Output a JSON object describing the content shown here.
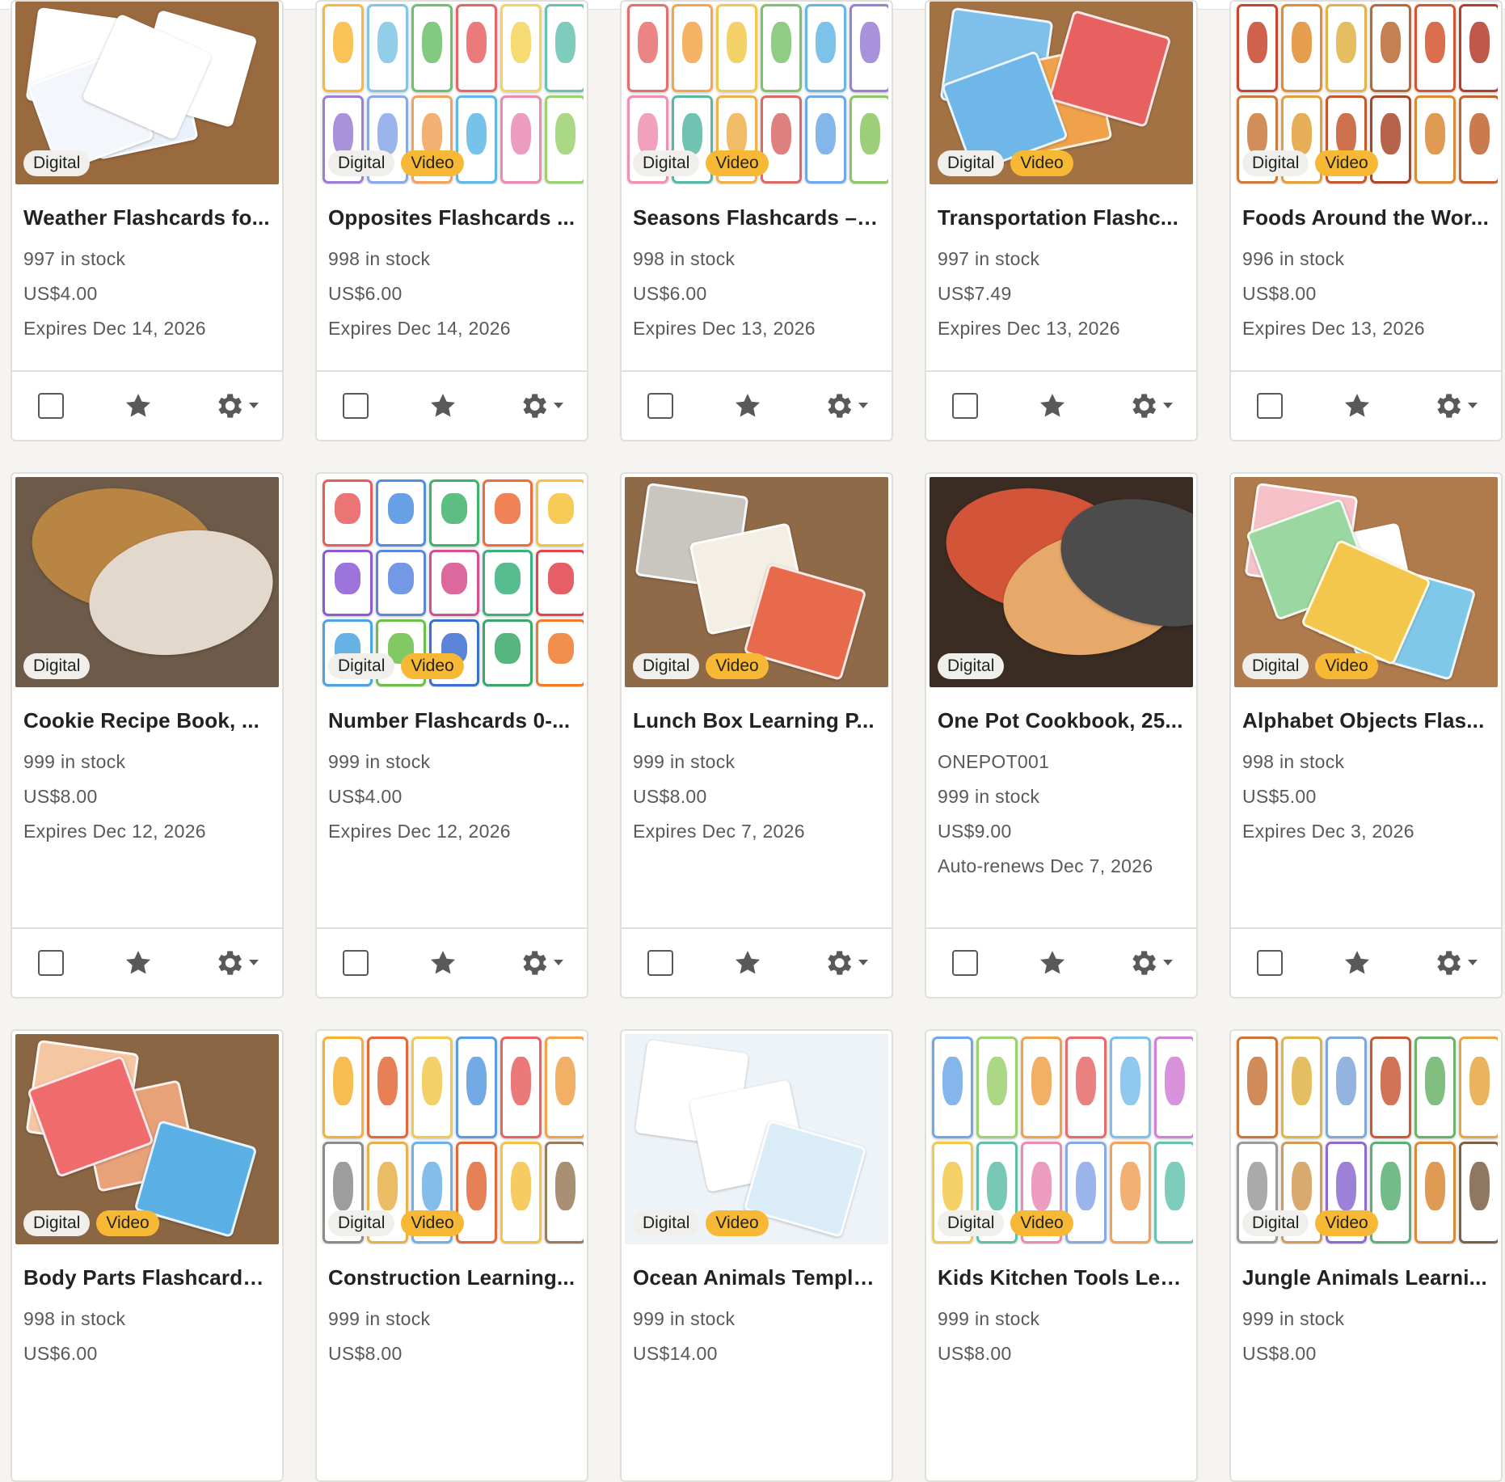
{
  "badges": {
    "digital": "Digital",
    "video": "Video"
  },
  "icons": {
    "star": "star-icon",
    "gear": "gear-icon",
    "caret": "chevron-down-icon"
  },
  "colors": {
    "video_badge": "#f7b935",
    "digital_badge": "#f1efeb",
    "text_muted": "#595959"
  },
  "listings": [
    {
      "title": "Weather Flashcards fo...",
      "lines": [
        "997 in stock",
        "US$4.00",
        "Expires Dec 14, 2026"
      ],
      "video": false,
      "art": "weather"
    },
    {
      "title": "Opposites Flashcards ...",
      "lines": [
        "998 in stock",
        "US$6.00",
        "Expires Dec 14, 2026"
      ],
      "video": true,
      "art": "opposites"
    },
    {
      "title": "Seasons Flashcards – ...",
      "lines": [
        "998 in stock",
        "US$6.00",
        "Expires Dec 13, 2026"
      ],
      "video": true,
      "art": "seasons"
    },
    {
      "title": "Transportation Flashc...",
      "lines": [
        "997 in stock",
        "US$7.49",
        "Expires Dec 13, 2026"
      ],
      "video": true,
      "art": "transport"
    },
    {
      "title": "Foods Around the Wor...",
      "lines": [
        "996 in stock",
        "US$8.00",
        "Expires Dec 13, 2026"
      ],
      "video": true,
      "art": "foods"
    },
    {
      "title": "Cookie Recipe Book, ...",
      "lines": [
        "999 in stock",
        "US$8.00",
        "Expires Dec 12, 2026"
      ],
      "video": false,
      "art": "cookie"
    },
    {
      "title": "Number Flashcards 0-...",
      "lines": [
        "999 in stock",
        "US$4.00",
        "Expires Dec 12, 2026"
      ],
      "video": true,
      "art": "numbers"
    },
    {
      "title": "Lunch Box Learning P...",
      "lines": [
        "999 in stock",
        "US$8.00",
        "Expires Dec 7, 2026"
      ],
      "video": true,
      "art": "lunchbox"
    },
    {
      "title": "One Pot Cookbook, 25...",
      "lines": [
        "ONEPOT001",
        "999 in stock",
        "US$9.00",
        "Auto-renews Dec 7, 2026"
      ],
      "video": false,
      "art": "onepot"
    },
    {
      "title": "Alphabet Objects Flas...",
      "lines": [
        "998 in stock",
        "US$5.00",
        "Expires Dec 3, 2026"
      ],
      "video": true,
      "art": "alphabet"
    },
    {
      "title": "Body Parts Flashcards...",
      "lines": [
        "998 in stock",
        "US$6.00"
      ],
      "video": true,
      "art": "body"
    },
    {
      "title": "Construction Learning...",
      "lines": [
        "999 in stock",
        "US$8.00"
      ],
      "video": true,
      "art": "construction"
    },
    {
      "title": "Ocean Animals Templa...",
      "lines": [
        "999 in stock",
        "US$14.00"
      ],
      "video": true,
      "art": "ocean"
    },
    {
      "title": "Kids Kitchen Tools Lea...",
      "lines": [
        "999 in stock",
        "US$8.00"
      ],
      "video": true,
      "art": "kitchen"
    },
    {
      "title": "Jungle Animals Learni...",
      "lines": [
        "999 in stock",
        "US$8.00"
      ],
      "video": true,
      "art": "jungle"
    }
  ]
}
